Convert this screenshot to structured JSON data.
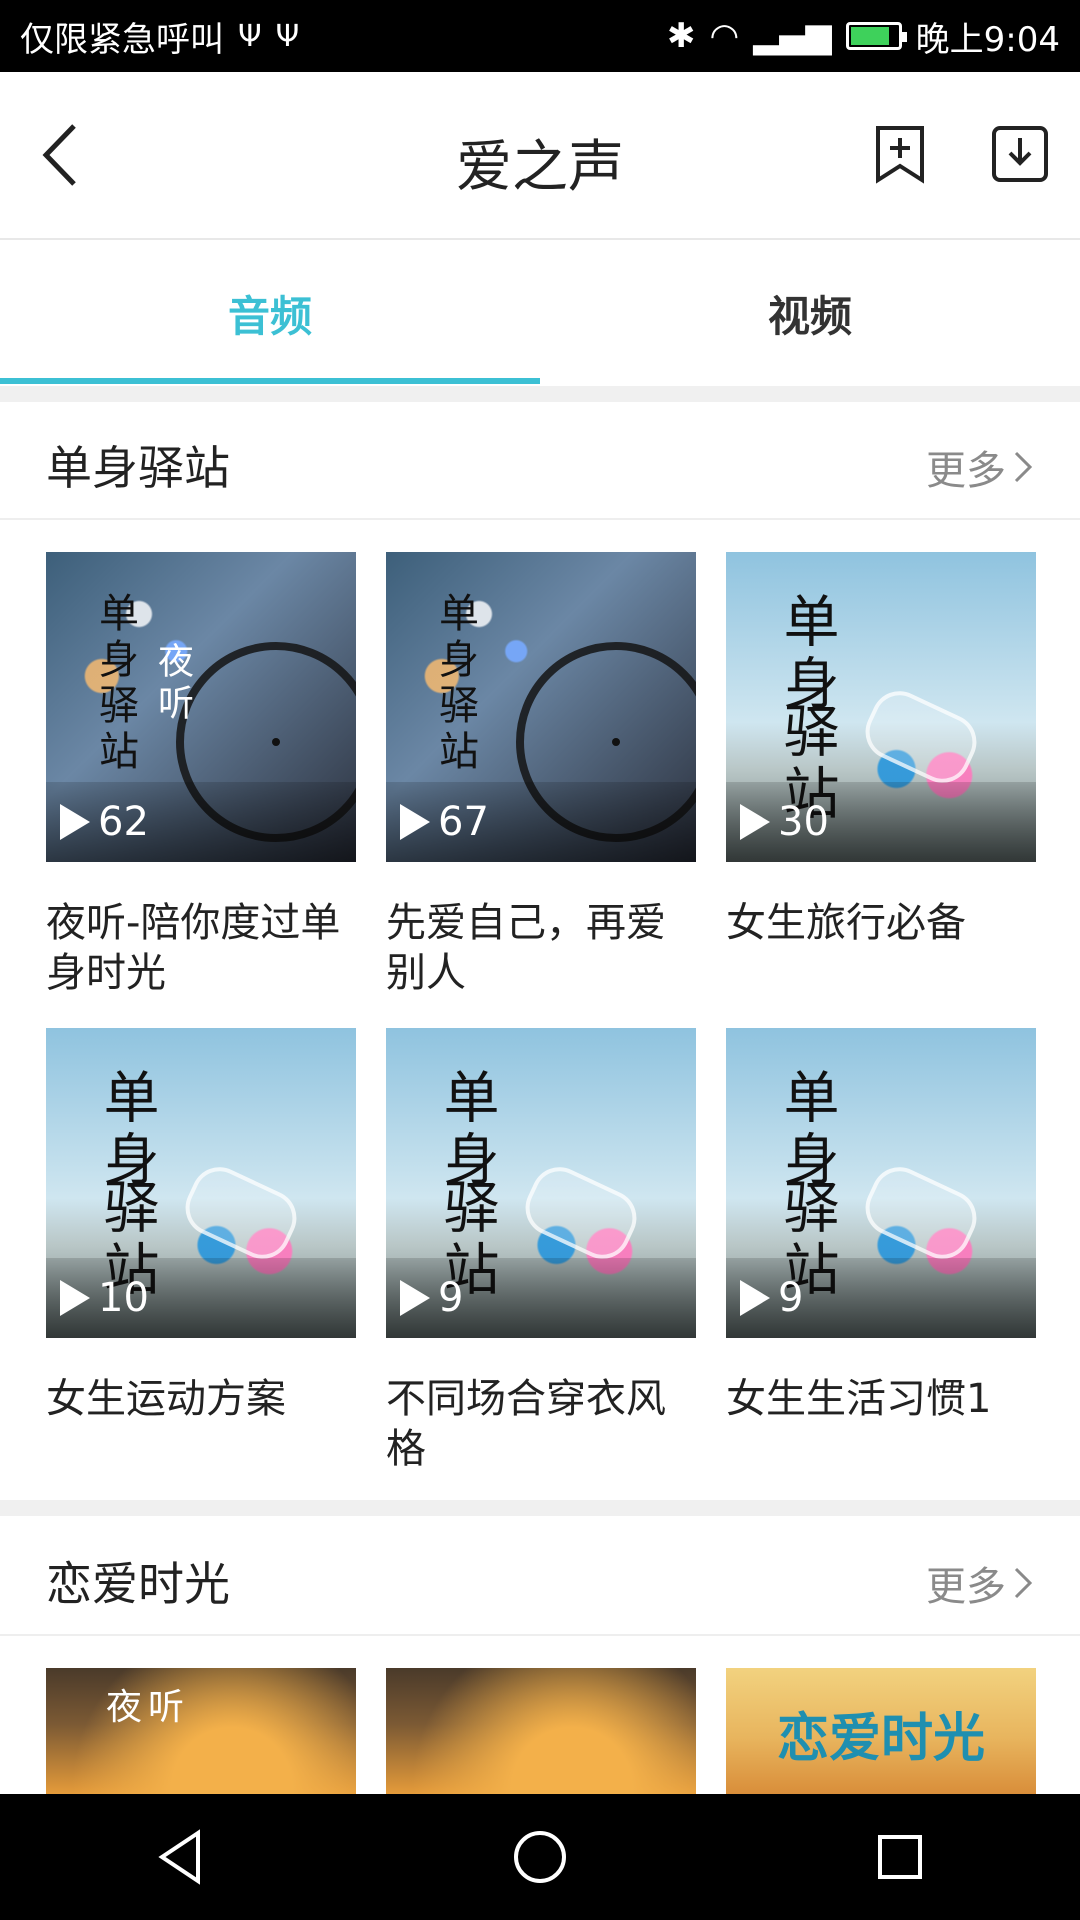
{
  "status_bar": {
    "emergency_text": "仅限紧急呼叫",
    "time": "晚上9:04"
  },
  "header": {
    "title": "爱之声"
  },
  "tabs": {
    "audio": "音频",
    "video": "视频"
  },
  "sections": [
    {
      "title": "单身驿站",
      "more": "更多",
      "items": [
        {
          "title": "夜听-陪你度过单身时光",
          "count": "62",
          "thumb": "bike"
        },
        {
          "title": "先爱自己，再爱别人",
          "count": "67",
          "thumb": "bike"
        },
        {
          "title": "女生旅行必备",
          "count": "30",
          "thumb": "sky"
        },
        {
          "title": "女生运动方案",
          "count": "10",
          "thumb": "sky"
        },
        {
          "title": "不同场合穿衣风格",
          "count": "9",
          "thumb": "sky"
        },
        {
          "title": "女生生活习惯1",
          "count": "9",
          "thumb": "sky"
        }
      ]
    },
    {
      "title": "恋爱时光",
      "more": "更多",
      "items": [
        {
          "thumb": "sunset",
          "overlay": "夜听"
        },
        {
          "thumb": "sunset"
        },
        {
          "thumb": "love",
          "overlay": "恋爱时光"
        }
      ]
    }
  ],
  "thumb_text": {
    "bike_a": "单身驿站",
    "bike_b": "夜听",
    "sky_a": "单身",
    "sky_b": "驿站"
  }
}
